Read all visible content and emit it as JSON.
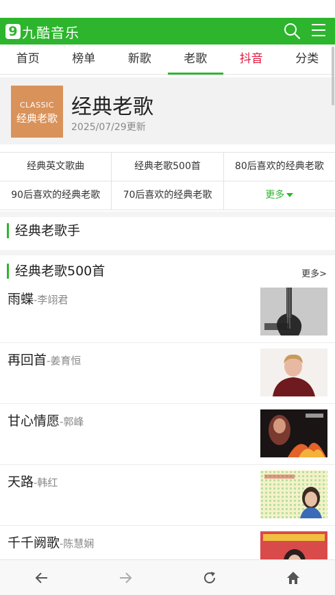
{
  "header": {
    "logo_text": "九酷音乐",
    "logo_mark": "9"
  },
  "nav": {
    "tabs": [
      {
        "label": "首页"
      },
      {
        "label": "榜单"
      },
      {
        "label": "新歌"
      },
      {
        "label": "老歌"
      },
      {
        "label": "抖音"
      },
      {
        "label": "分类"
      }
    ],
    "active_index": 3
  },
  "album": {
    "cover_line1": "CLASSIC",
    "cover_line2": "经典老歌",
    "title": "经典老歌",
    "updated": "2025/07/29更新"
  },
  "categories": [
    [
      "经典英文歌曲",
      "经典老歌500首",
      "80后喜欢的经典老歌"
    ],
    [
      "90后喜欢的经典老歌",
      "70后喜欢的经典老歌",
      "更多"
    ]
  ],
  "sections": {
    "singers_title": "经典老歌手",
    "list_title": "经典老歌500首",
    "list_more": "更多>"
  },
  "songs": [
    {
      "title": "雨蝶",
      "artist": "-李翊君"
    },
    {
      "title": "再回首",
      "artist": "-姜育恒"
    },
    {
      "title": "甘心情愿",
      "artist": "-郭峰"
    },
    {
      "title": "天路",
      "artist": "-韩红"
    },
    {
      "title": "千千阙歌",
      "artist": "-陈慧娴"
    }
  ],
  "colors": {
    "brand_green": "#2db52d",
    "hot_red": "#e0183c"
  }
}
